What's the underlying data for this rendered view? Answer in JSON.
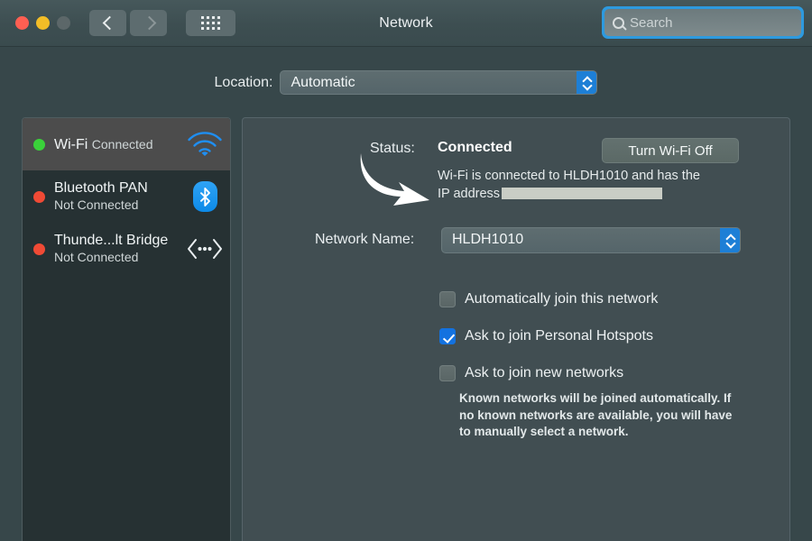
{
  "window": {
    "title": "Network",
    "traffic_lights": [
      "close",
      "minimize",
      "zoom"
    ]
  },
  "toolbar": {
    "back_icon": "chevron-left-icon",
    "forward_icon": "chevron-right-icon",
    "grid_icon": "grid-view-icon",
    "search": {
      "placeholder": "Search",
      "value": "",
      "icon": "search-icon",
      "focused": true,
      "focus_color": "#2d9adf"
    }
  },
  "location": {
    "label": "Location:",
    "selected": "Automatic",
    "options": [
      "Automatic"
    ]
  },
  "sidebar": {
    "services": [
      {
        "name": "Wi-Fi",
        "state": "Connected",
        "status_color": "#3ad13a",
        "icon": "wifi-icon",
        "selected": true
      },
      {
        "name": "Bluetooth PAN",
        "state": "Not Connected",
        "status_color": "#f04a35",
        "icon": "bluetooth-icon",
        "selected": false
      },
      {
        "name": "Thunde...lt Bridge",
        "state": "Not Connected",
        "status_color": "#f04a35",
        "icon": "thunderbolt-icon",
        "selected": false
      }
    ]
  },
  "panel": {
    "status": {
      "label": "Status:",
      "value": "Connected",
      "toggle_button": "Turn Wi-Fi Off",
      "description_prefix": "Wi-Fi is connected to HLDH1010 and has the IP address",
      "ip_address_redacted": true
    },
    "annotation": {
      "icon": "curved-arrow-icon",
      "color": "#ffffff"
    },
    "network_name": {
      "label": "Network Name:",
      "selected": "HLDH1010",
      "options": [
        "HLDH1010"
      ]
    },
    "checkboxes": [
      {
        "label": "Automatically join this network",
        "checked": false
      },
      {
        "label": "Ask to join Personal Hotspots",
        "checked": true
      },
      {
        "label": "Ask to join new networks",
        "checked": false
      }
    ],
    "help_text": "Known networks will be joined automatically. If no known networks are available, you will have to manually select a network."
  },
  "colors": {
    "accent_blue": "#1372e0",
    "window_bg": "#37474a",
    "sidebar_bg": "#263133",
    "panel_bg": "#414e52",
    "wifi_icon": "#1f8ef1"
  }
}
